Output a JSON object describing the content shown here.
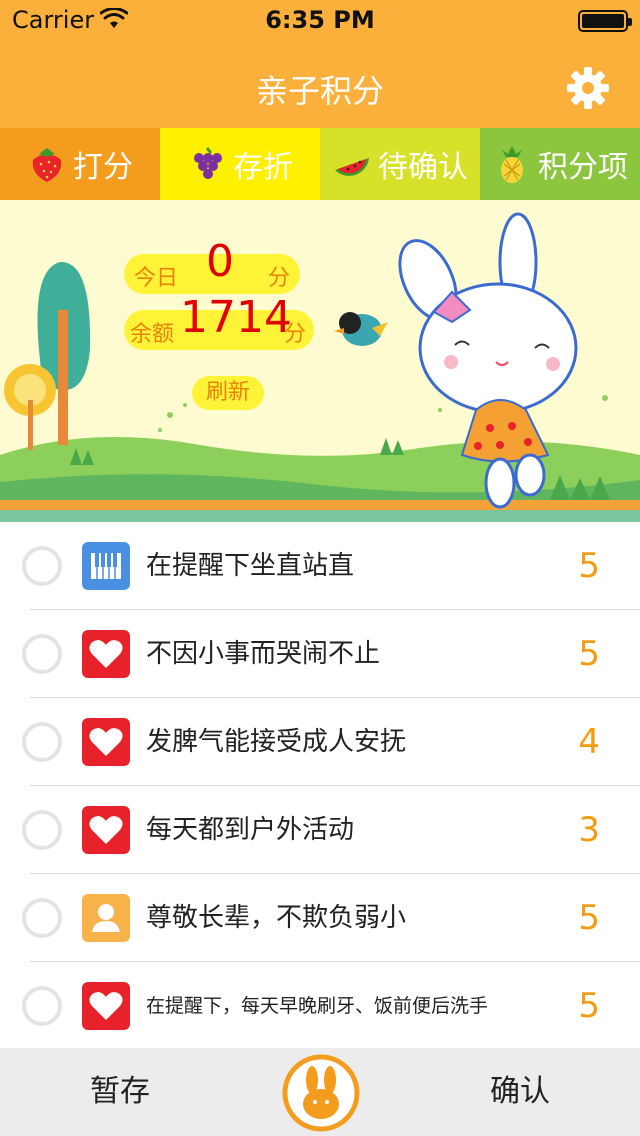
{
  "status": {
    "carrier": "Carrier",
    "time": "6:35 PM"
  },
  "nav": {
    "title": "亲子积分",
    "settings_icon": "gear-icon"
  },
  "tabs": [
    {
      "label": "打分",
      "icon": "strawberry-icon",
      "color": "#f39c1e"
    },
    {
      "label": "存折",
      "icon": "grape-icon",
      "color": "#fff000"
    },
    {
      "label": "待确认",
      "icon": "watermelon-icon",
      "color": "#d7e12a"
    },
    {
      "label": "积分项",
      "icon": "pineapple-icon",
      "color": "#8cc63f"
    }
  ],
  "banner": {
    "today_label": "今日",
    "today_value": "0",
    "today_unit": "分",
    "balance_label": "余额",
    "balance_value": "1714",
    "balance_unit": "分",
    "refresh_label": "刷新"
  },
  "items": [
    {
      "title": "在提醒下坐直站直",
      "score": "5",
      "icon": "piano-icon",
      "icon_color": "#4a90e2"
    },
    {
      "title": "不因小事而哭闹不止",
      "score": "5",
      "icon": "heart-icon",
      "icon_color": "#e8222a"
    },
    {
      "title": "发脾气能接受成人安抚",
      "score": "4",
      "icon": "heart-icon",
      "icon_color": "#e8222a"
    },
    {
      "title": "每天都到户外活动",
      "score": "3",
      "icon": "heart-icon",
      "icon_color": "#e8222a"
    },
    {
      "title": "尊敬长辈，不欺负弱小",
      "score": "5",
      "icon": "person-icon",
      "icon_color": "#f8b24a"
    },
    {
      "title": "在提醒下，每天早晚刷牙、饭前便后洗手",
      "score": "5",
      "icon": "heart-icon",
      "icon_color": "#e8222a"
    }
  ],
  "bottom": {
    "save_label": "暂存",
    "confirm_label": "确认",
    "center_icon": "bunny-icon"
  },
  "colors": {
    "nav_bg": "#fbb03b",
    "score": "#f39c12",
    "value_red": "#e00000"
  }
}
